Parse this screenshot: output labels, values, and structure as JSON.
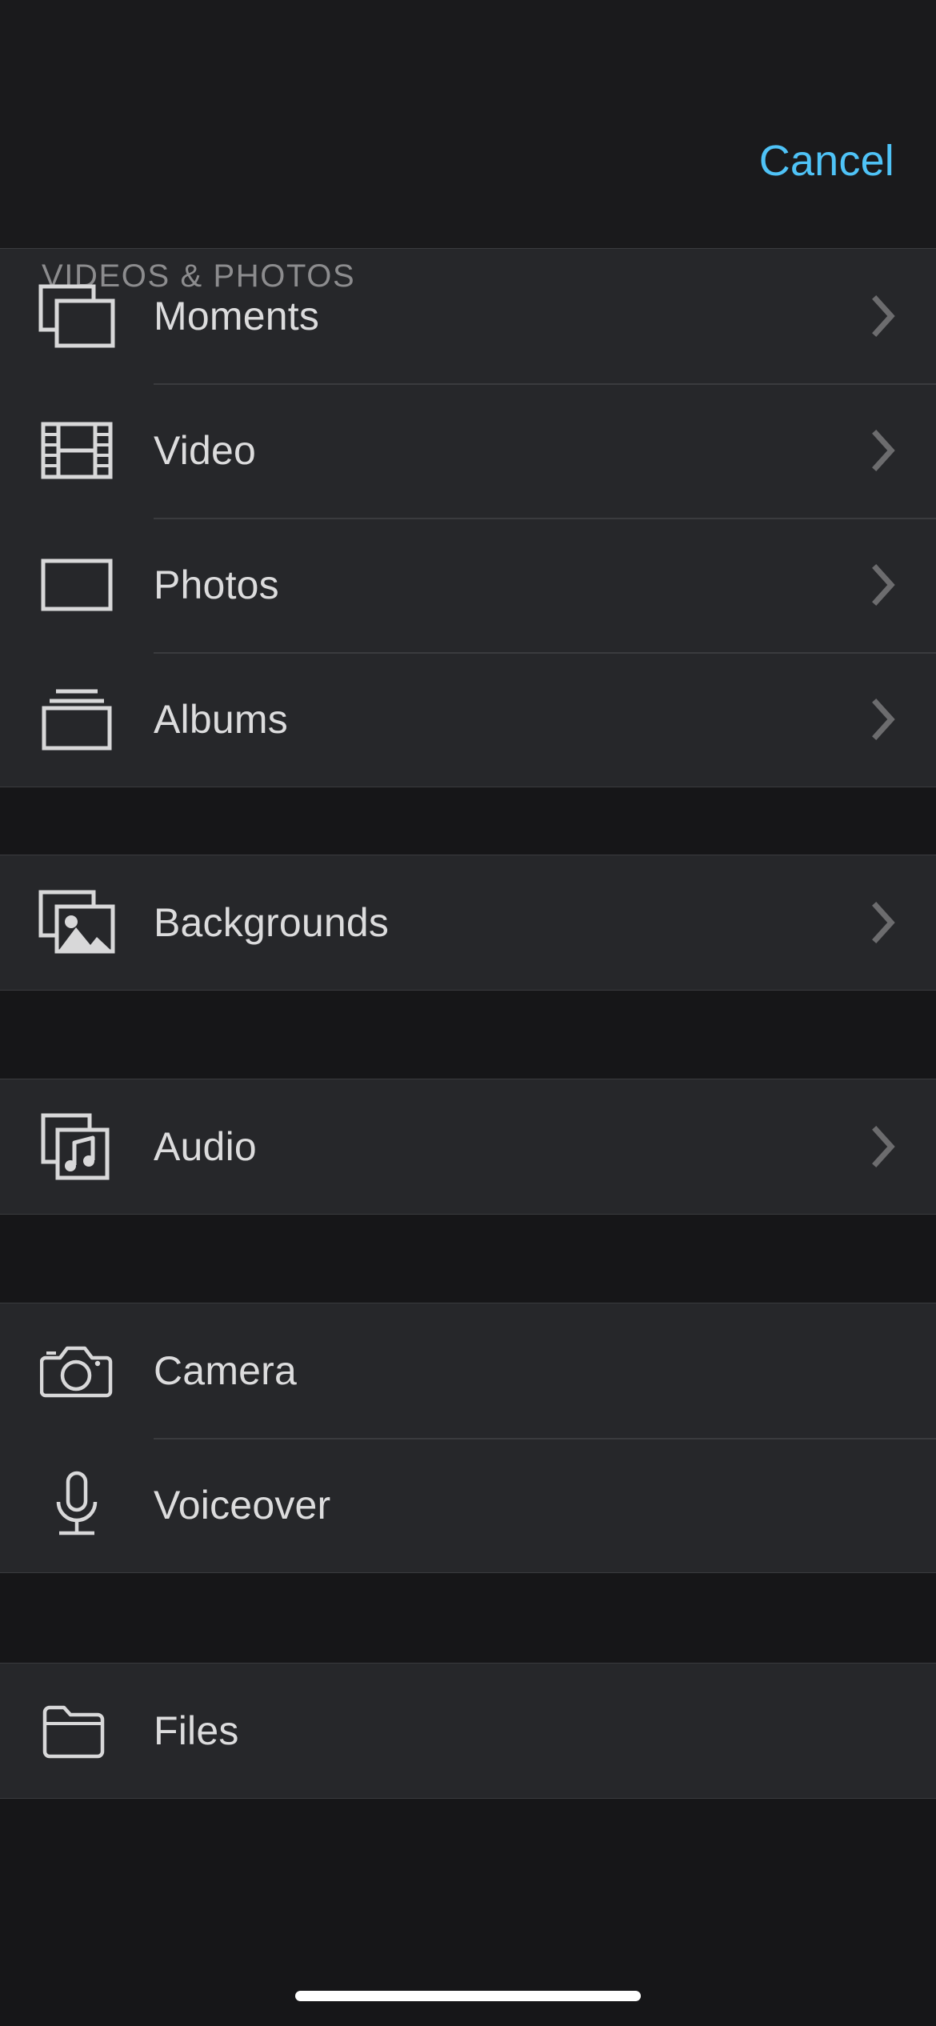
{
  "header": {
    "cancel_label": "Cancel",
    "section_title": "VIDEOS & PHOTOS",
    "accent_color": "#4fc3f7",
    "title_color": "#8c8c8e"
  },
  "theme": {
    "background": "#1a1a1c",
    "row_background": "#26272a",
    "gap_background": "#161618",
    "separator": "#3a3b3e",
    "label_color": "#dcdcdd",
    "chevron_color": "#6c6c6e",
    "icon_color": "#d8d8d9",
    "home_indicator_color": "#ffffff"
  },
  "sections": [
    {
      "name": "videos-and-photos",
      "items": [
        {
          "label": "Moments",
          "icon": "stacked-photos-icon",
          "chevron": true
        },
        {
          "label": "Video",
          "icon": "film-strip-icon",
          "chevron": true
        },
        {
          "label": "Photos",
          "icon": "photo-frame-icon",
          "chevron": true
        },
        {
          "label": "Albums",
          "icon": "albums-stack-icon",
          "chevron": true
        }
      ]
    },
    {
      "name": "backgrounds",
      "items": [
        {
          "label": "Backgrounds",
          "icon": "picture-stack-icon",
          "chevron": true
        }
      ]
    },
    {
      "name": "audio",
      "items": [
        {
          "label": "Audio",
          "icon": "music-note-stack-icon",
          "chevron": true
        }
      ]
    },
    {
      "name": "capture",
      "items": [
        {
          "label": "Camera",
          "icon": "camera-icon",
          "chevron": false
        },
        {
          "label": "Voiceover",
          "icon": "microphone-icon",
          "chevron": false
        }
      ]
    },
    {
      "name": "files",
      "items": [
        {
          "label": "Files",
          "icon": "folder-icon",
          "chevron": false
        }
      ]
    }
  ]
}
